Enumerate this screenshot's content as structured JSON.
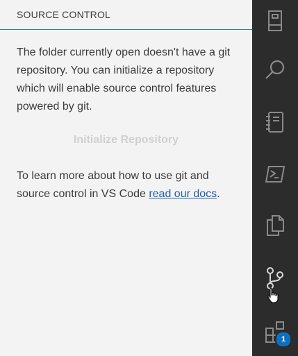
{
  "sidebar": {
    "title": "SOURCE CONTROL",
    "message": "The folder currently open doesn't have a git repository. You can initialize a repository which will enable source control features powered by git.",
    "init_button": "Initialize Repository",
    "learn_prefix": "To learn more about how to use git and source control in VS Code ",
    "learn_link": "read our docs",
    "learn_suffix": "."
  },
  "activity_bar": {
    "items": [
      {
        "icon": "explorer-icon"
      },
      {
        "icon": "search-icon"
      },
      {
        "icon": "notebook-icon"
      },
      {
        "icon": "terminal-icon"
      },
      {
        "icon": "copy-files-icon"
      },
      {
        "icon": "source-control-icon"
      },
      {
        "icon": "extensions-icon",
        "badge": "1"
      }
    ]
  },
  "colors": {
    "accent": "#2f7db3",
    "activity_bar_bg": "#2c2c2c",
    "badge": "#0e70c0",
    "link": "#1f5fa8"
  }
}
